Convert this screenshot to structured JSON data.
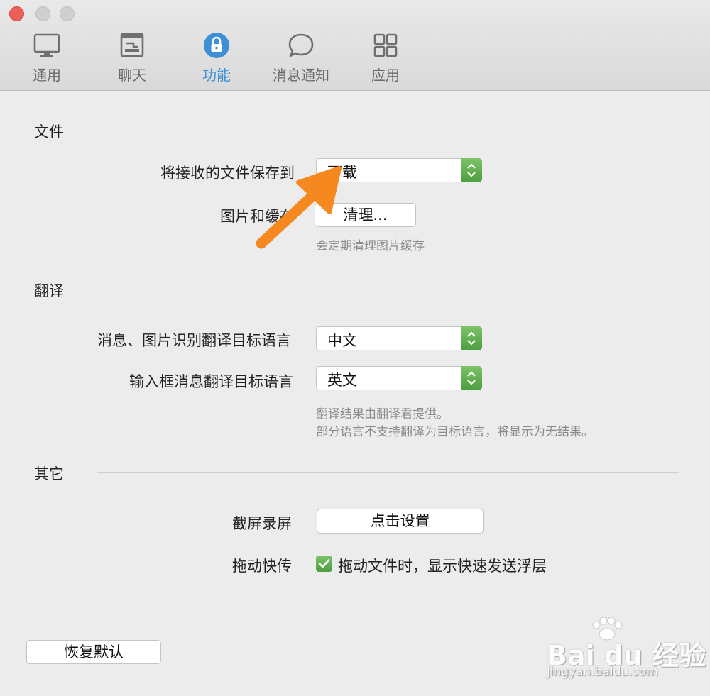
{
  "toolbar": {
    "tabs": [
      {
        "label": "通用",
        "icon": "monitor-icon"
      },
      {
        "label": "聊天",
        "icon": "chat-window-icon"
      },
      {
        "label": "功能",
        "icon": "lock-icon",
        "active": true
      },
      {
        "label": "消息通知",
        "icon": "speech-bubble-icon"
      },
      {
        "label": "应用",
        "icon": "grid-icon"
      }
    ]
  },
  "files": {
    "title": "文件",
    "save_label": "将接收的文件保存到",
    "save_value": "下载",
    "cache_label": "图片和缓存",
    "cache_button": "清理...",
    "cache_hint": "会定期清理图片缓存"
  },
  "translate": {
    "title": "翻译",
    "msg_label": "消息、图片识别翻译目标语言",
    "msg_value": "中文",
    "input_label": "输入框消息翻译目标语言",
    "input_value": "英文",
    "hint_line1": "翻译结果由翻译君提供。",
    "hint_line2": "部分语言不支持翻译为目标语言，将显示为无结果。"
  },
  "other": {
    "title": "其它",
    "screenshot_label": "截屏录屏",
    "screenshot_button": "点击设置",
    "drag_label": "拖动快传",
    "drag_checkbox_label": "拖动文件时，显示快速发送浮层",
    "drag_checked": true
  },
  "footer": {
    "restore_button": "恢复默认"
  },
  "watermark": {
    "brand": "Bai du 经验",
    "url": "jingyan.baidu.com"
  },
  "colors": {
    "accent_blue": "#3d8fd6",
    "stepper_green": "#5aab48",
    "arrow_orange": "#f5891f",
    "close_red": "#ec5f57"
  }
}
